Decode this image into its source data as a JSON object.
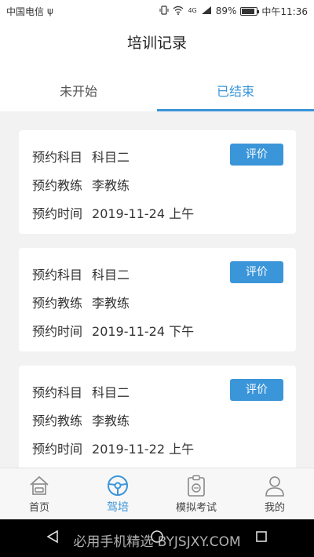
{
  "status_bar": {
    "carrier": "中国电信",
    "usb_symbol": "ψ",
    "network": "4G",
    "battery": "89%",
    "battery_level": 0.89,
    "time": "中午11:36"
  },
  "header": {
    "title": "培训记录"
  },
  "tabs": [
    {
      "label": "未开始",
      "active": false
    },
    {
      "label": "已结束",
      "active": true
    }
  ],
  "records": [
    {
      "subject_label": "预约科目",
      "subject": "科目二",
      "coach_label": "预约教练",
      "coach": "李教练",
      "time_label": "预约时间",
      "time": "2019-11-24 上午",
      "button": "评价"
    },
    {
      "subject_label": "预约科目",
      "subject": "科目二",
      "coach_label": "预约教练",
      "coach": "李教练",
      "time_label": "预约时间",
      "time": "2019-11-24 下午",
      "button": "评价"
    },
    {
      "subject_label": "预约科目",
      "subject": "科目二",
      "coach_label": "预约教练",
      "coach": "李教练",
      "time_label": "预约时间",
      "time": "2019-11-22 上午",
      "button": "评价"
    }
  ],
  "bottom_nav": [
    {
      "label": "首页",
      "icon": "home-icon",
      "active": false
    },
    {
      "label": "驾培",
      "icon": "steering-wheel-icon",
      "active": true
    },
    {
      "label": "模拟考试",
      "icon": "exam-clipboard-icon",
      "active": false
    },
    {
      "label": "我的",
      "icon": "profile-icon",
      "active": false
    }
  ],
  "watermark": "必用手机精选 BYJSJXY.COM",
  "colors": {
    "accent": "#3b95d9",
    "background": "#f2f2f2"
  }
}
